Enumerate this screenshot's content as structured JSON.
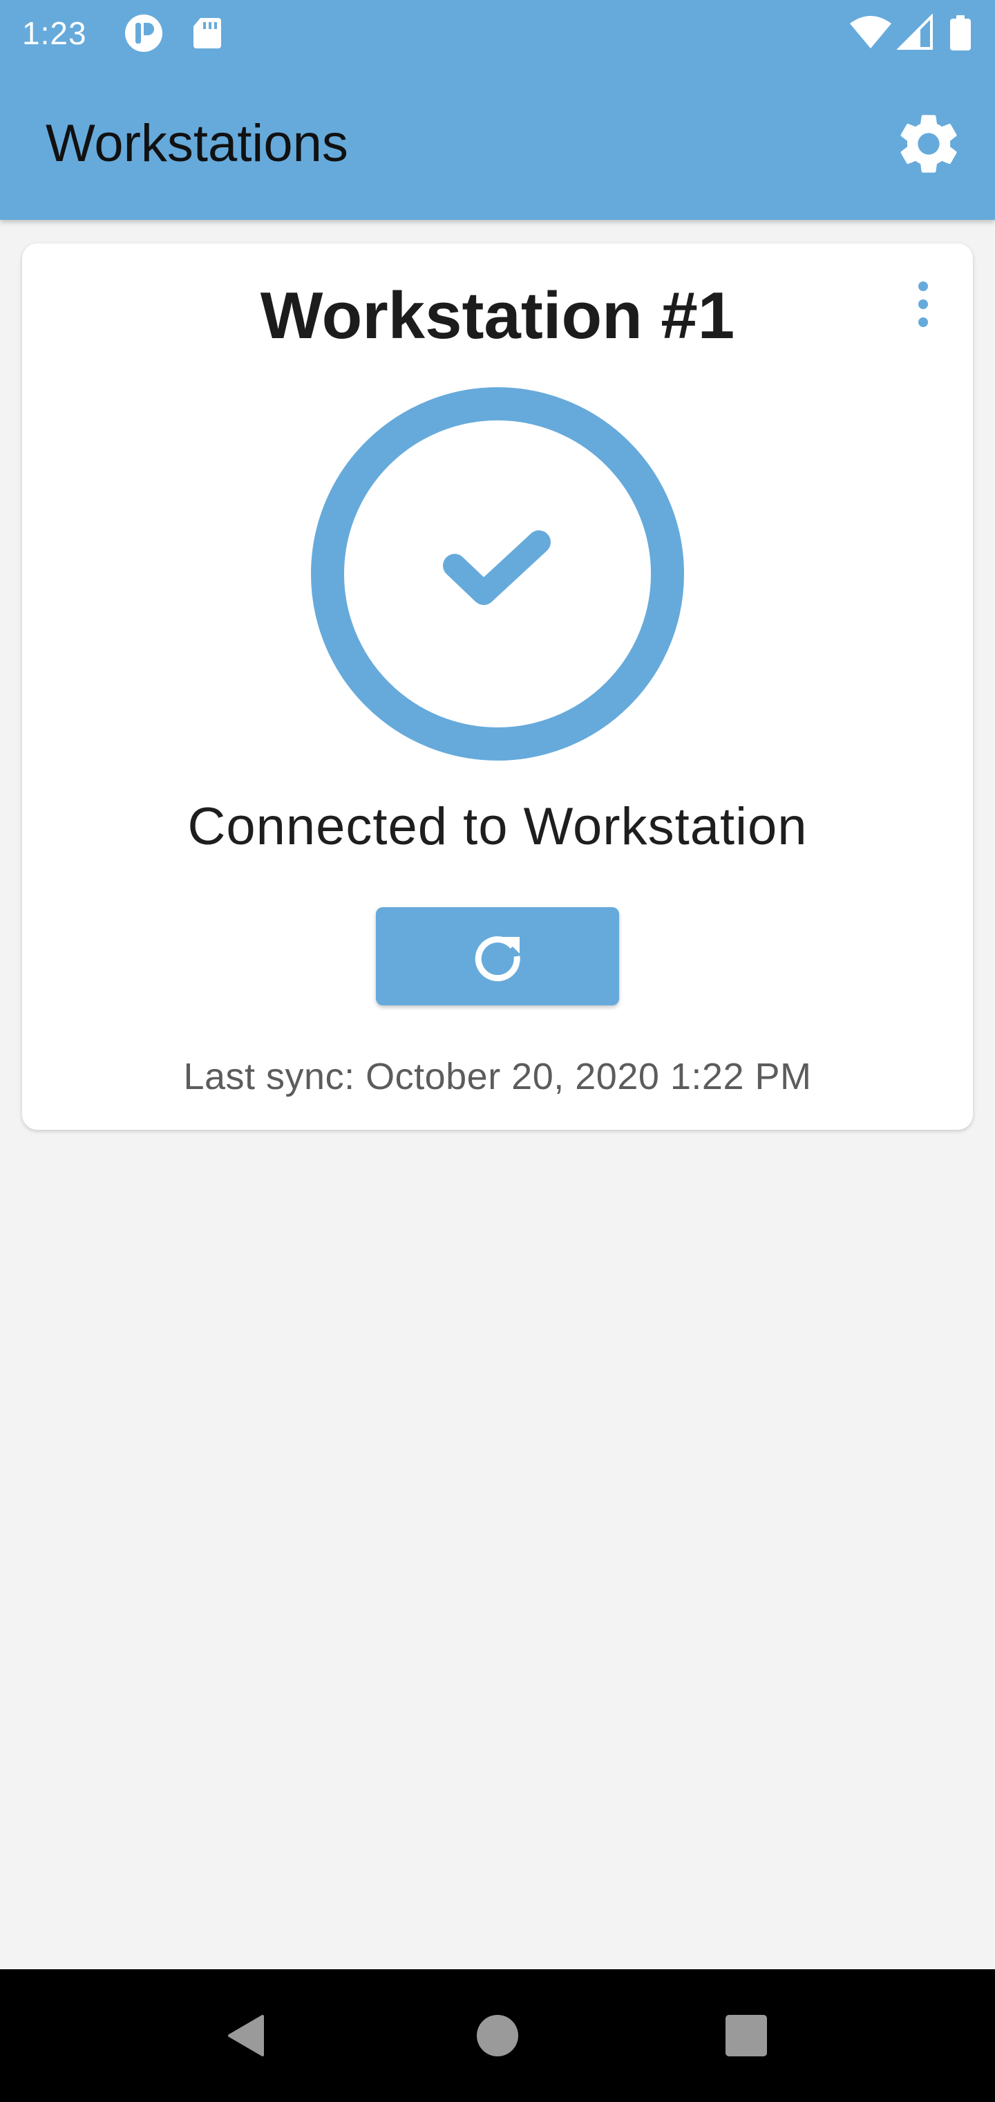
{
  "status_bar": {
    "time": "1:23",
    "icons": [
      "app-notification-icon",
      "sd-card-icon",
      "wifi-icon",
      "cell-signal-icon",
      "battery-icon"
    ]
  },
  "app_bar": {
    "title": "Workstations",
    "settings_icon": "gear-icon"
  },
  "card": {
    "title": "Workstation #1",
    "menu_icon": "more-vert-icon",
    "status_icon": "check-circle-icon",
    "status_text": "Connected to Workstation",
    "sync_button_icon": "refresh-icon",
    "last_sync": "Last sync: October 20, 2020 1:22 PM"
  },
  "nav_bar": {
    "back_icon": "back-triangle-icon",
    "home_icon": "home-circle-icon",
    "recents_icon": "recents-square-icon"
  },
  "colors": {
    "accent": "#66aadb",
    "background": "#f3f3f3",
    "card": "#ffffff",
    "nav_bar": "#000000"
  }
}
